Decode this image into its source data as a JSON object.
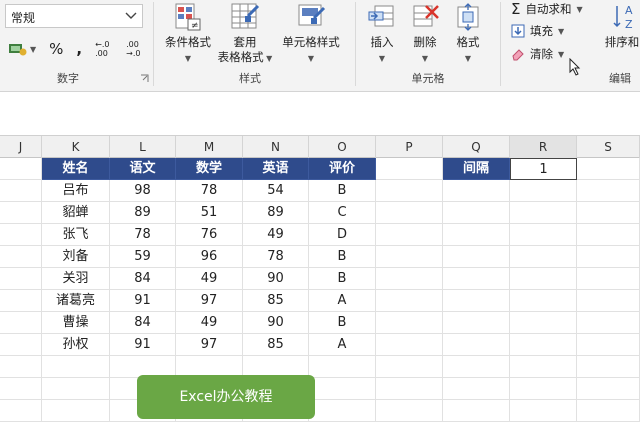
{
  "ribbon": {
    "number_format_value": "常规",
    "percent_symbol": "%",
    "comma_symbol": ",",
    "decimal_increase": "←.0 .00",
    "decimal_decrease": ".00 →.0",
    "groups": {
      "number": "数字",
      "styles": "样式",
      "cells": "单元格",
      "editing": "编辑"
    },
    "styles": {
      "conditional_format": "条件格式",
      "table_format_line1": "套用",
      "table_format_line2": "表格格式",
      "cell_styles": "单元格样式"
    },
    "cells": {
      "insert": "插入",
      "delete": "删除",
      "format": "格式"
    },
    "editing": {
      "autosum": "自动求和",
      "fill": "填充",
      "clear": "清除",
      "sort_filter": "排序和"
    },
    "colors": {
      "ribbon_bg": "#f3f3f3",
      "accent_blue": "#2f4b8c"
    }
  },
  "sheet": {
    "columns": [
      "J",
      "K",
      "L",
      "M",
      "N",
      "O",
      "P",
      "Q",
      "R",
      "S"
    ],
    "selected_column": "R",
    "table_headers": [
      "姓名",
      "语文",
      "数学",
      "英语",
      "评价"
    ],
    "rows": [
      [
        "吕布",
        "98",
        "78",
        "54",
        "B"
      ],
      [
        "貂蝉",
        "89",
        "51",
        "89",
        "C"
      ],
      [
        "张飞",
        "78",
        "76",
        "49",
        "D"
      ],
      [
        "刘备",
        "59",
        "96",
        "78",
        "B"
      ],
      [
        "关羽",
        "84",
        "49",
        "90",
        "B"
      ],
      [
        "诸葛亮",
        "91",
        "97",
        "85",
        "A"
      ],
      [
        "曹操",
        "84",
        "49",
        "90",
        "B"
      ],
      [
        "孙权",
        "91",
        "97",
        "85",
        "A"
      ]
    ],
    "interval_label": "间隔",
    "interval_value": "1",
    "colors": {
      "header_fill": "#2f4b8c",
      "header_text": "#ffffff"
    }
  },
  "watermark": {
    "text": "Excel办公教程",
    "color": "#6aa745"
  }
}
